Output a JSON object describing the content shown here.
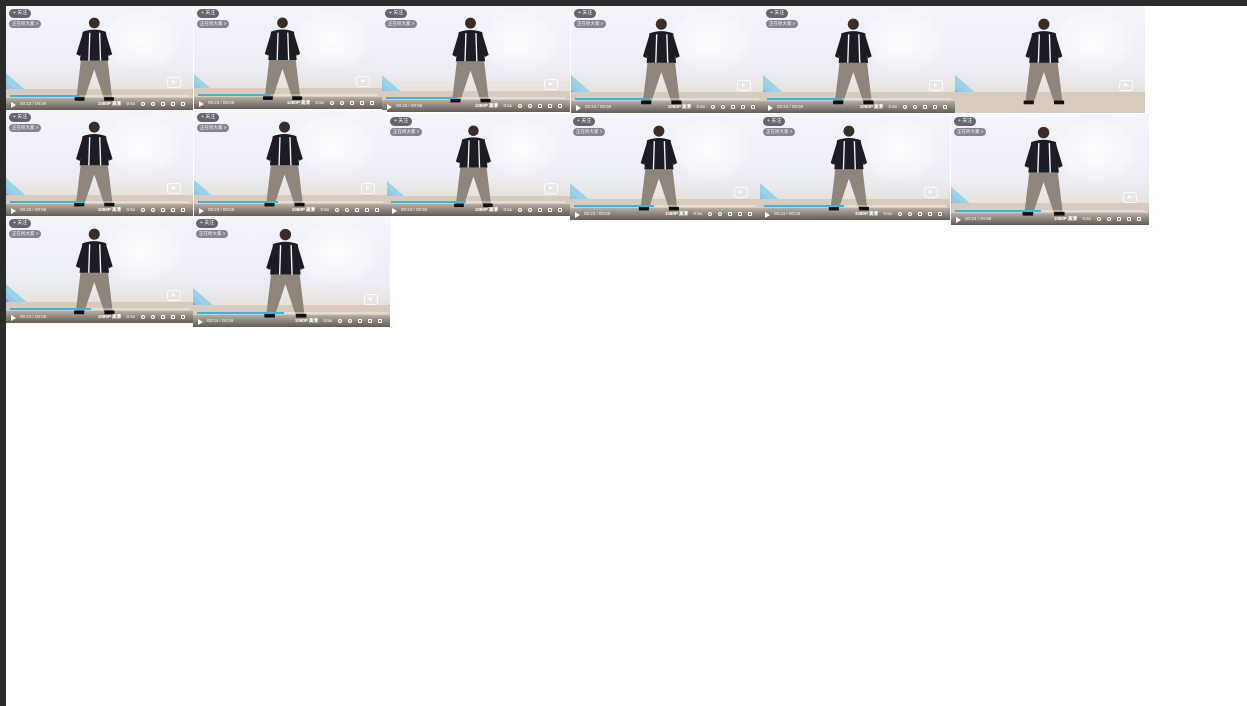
{
  "window": {
    "colors": {
      "frame_border": "#2b2b2b",
      "canvas": "#ffffff",
      "accent_progress": "#35b6e5",
      "stripe_cyan": "#8fd0e8",
      "stripe_purple": "#8a7fe6"
    }
  },
  "player": {
    "quality_label": "1080P 高清",
    "speed_label": "0.5x",
    "badge_text": "+ 关注",
    "subtitle_text": "正在听大家 >",
    "icons": [
      "play-icon",
      "volume-icon",
      "settings-icon",
      "pip-icon",
      "widescreen-icon",
      "fullscreen-icon",
      "tv-logo-icon"
    ]
  },
  "frames": [
    {
      "time": "00:23 / 00:59",
      "progress": 0.39
    },
    {
      "time": "00:23 / 00:59",
      "progress": 0.4
    },
    {
      "time": "00:23 / 00:59",
      "progress": 0.4
    },
    {
      "time": "00:23 / 00:59",
      "progress": 0.41
    },
    {
      "time": "00:23 / 00:59",
      "progress": 0.41
    },
    {
      "time": "",
      "progress": 0.42
    },
    {
      "time": "00:23 / 00:59",
      "progress": 0.42
    },
    {
      "time": "00:23 / 00:59",
      "progress": 0.43
    },
    {
      "time": "00:23 / 00:59",
      "progress": 0.43
    },
    {
      "time": "00:23 / 00:59",
      "progress": 0.44
    },
    {
      "time": "00:23 / 00:59",
      "progress": 0.44
    },
    {
      "time": "00:23 / 00:59",
      "progress": 0.45
    },
    {
      "time": "00:24 / 00:59",
      "progress": 0.45
    },
    {
      "time": "00:24 / 00:59",
      "progress": 0.46
    }
  ]
}
